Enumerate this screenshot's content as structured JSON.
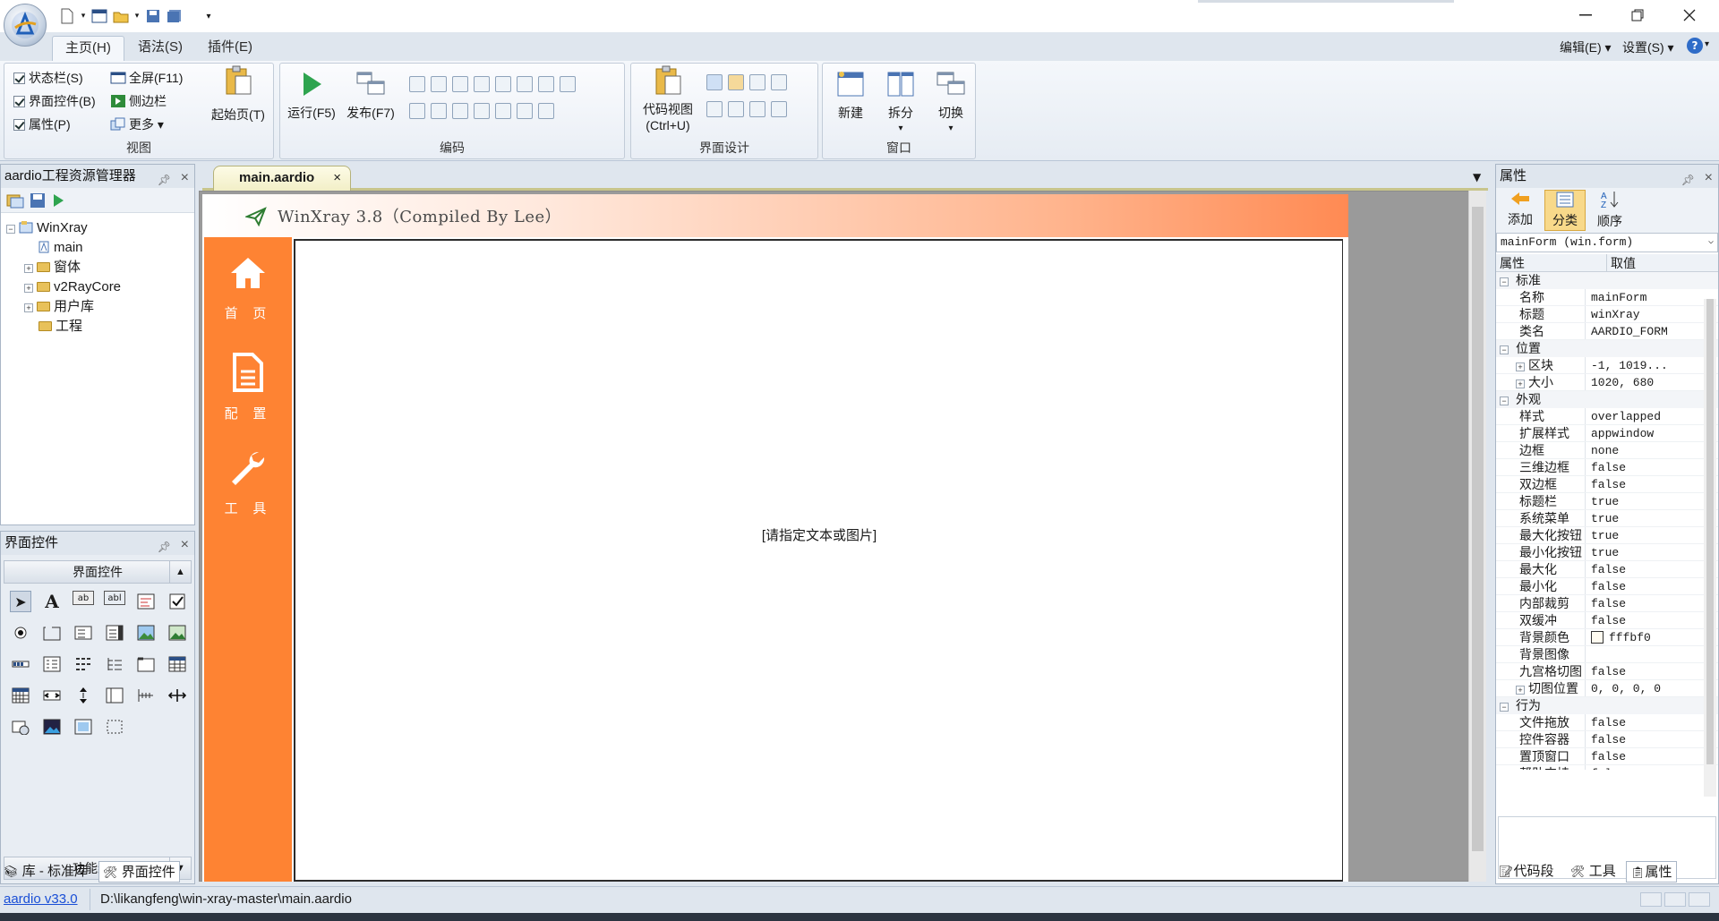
{
  "titlebar": {
    "window_buttons": [
      "minimize-icon",
      "restore-icon",
      "close-icon"
    ]
  },
  "ribbon": {
    "tabs": [
      "主页(H)",
      "语法(S)",
      "插件(E)"
    ],
    "right_menu": {
      "edit": "编辑(E)",
      "settings": "设置(S)"
    },
    "view_group": {
      "label": "视图",
      "statusbar": "状态栏(S)",
      "ui_controls": "界面控件(B)",
      "properties": "属性(P)",
      "fullscreen": "全屏(F11)",
      "sidebar": "侧边栏",
      "more": "更多",
      "start_page": "起始页(T)"
    },
    "code_group": {
      "label": "编码",
      "run": "运行(F5)",
      "publish": "发布(F7)"
    },
    "ui_design_group": {
      "label": "界面设计",
      "code_view": "代码视图",
      "code_view_shortcut": "(Ctrl+U)"
    },
    "window_group": {
      "label": "窗口",
      "new": "新建",
      "split": "拆分",
      "switch": "切换"
    }
  },
  "project_explorer": {
    "title": "aardio工程资源管理器",
    "tree": {
      "root": "WinXray",
      "main": "main",
      "forms": "窗体",
      "v2raycore": "v2RayCore",
      "user_lib": "用户库",
      "project": "工程"
    }
  },
  "controls_panel": {
    "title": "界面控件",
    "section_header": "界面控件",
    "footer_section": "功能组件"
  },
  "left_bottom_tabs": {
    "lib": "库 - 标准库",
    "controls": "界面控件"
  },
  "document": {
    "tab": "main.aardio",
    "form_title": "WinXray 3.8（Compiled By Lee）",
    "nav": [
      {
        "label": "首 页",
        "icon": "home-icon"
      },
      {
        "label": "配 置",
        "icon": "document-icon"
      },
      {
        "label": "工 具",
        "icon": "wrench-icon"
      }
    ],
    "placeholder": "[请指定文本或图片]"
  },
  "properties_panel": {
    "title": "属性",
    "toolbar": {
      "add": "添加",
      "categorize": "分类",
      "order": "顺序"
    },
    "object_selector": "mainForm (win.form)",
    "headers": {
      "name": "属性",
      "value": "取值"
    },
    "categories": [
      {
        "name": "标准",
        "rows": [
          {
            "name": "名称",
            "value": "mainForm"
          },
          {
            "name": "标题",
            "value": "winXray"
          },
          {
            "name": "类名",
            "value": "AARDIO_FORM"
          }
        ]
      },
      {
        "name": "位置",
        "rows": [
          {
            "name": "区块",
            "value": "-1, 1019...",
            "expandable": true
          },
          {
            "name": "大小",
            "value": "1020, 680",
            "expandable": true
          }
        ]
      },
      {
        "name": "外观",
        "rows": [
          {
            "name": "样式",
            "value": "overlapped"
          },
          {
            "name": "扩展样式",
            "value": "appwindow"
          },
          {
            "name": "边框",
            "value": "none"
          },
          {
            "name": "三维边框",
            "value": "false"
          },
          {
            "name": "双边框",
            "value": "false"
          },
          {
            "name": "标题栏",
            "value": "true"
          },
          {
            "name": "系统菜单",
            "value": "true"
          },
          {
            "name": "最大化按钮",
            "value": "true"
          },
          {
            "name": "最小化按钮",
            "value": "true"
          },
          {
            "name": "最大化",
            "value": "false"
          },
          {
            "name": "最小化",
            "value": "false"
          },
          {
            "name": "内部裁剪",
            "value": "false"
          },
          {
            "name": "双缓冲",
            "value": "false"
          },
          {
            "name": "背景颜色",
            "value": "fffbf0",
            "swatch": "#fffbf0"
          },
          {
            "name": "背景图像",
            "value": ""
          },
          {
            "name": "九宫格切图",
            "value": "false"
          },
          {
            "name": "切图位置",
            "value": "0, 0, 0, 0",
            "expandable": true
          }
        ]
      },
      {
        "name": "行为",
        "rows": [
          {
            "name": "文件拖放",
            "value": "false"
          },
          {
            "name": "控件容器",
            "value": "false"
          },
          {
            "name": "置顶窗口",
            "value": "false"
          },
          {
            "name": "帮助支持",
            "value": "false"
          }
        ]
      }
    ],
    "bottom_tabs": {
      "snippets": "代码段",
      "tools": "工具",
      "properties": "属性"
    }
  },
  "statusbar": {
    "version_link": "aardio v33.0",
    "path": "D:\\likangfeng\\win-xray-master\\main.aardio"
  },
  "colors": {
    "accent_orange": "#fe8333",
    "header_gradient_end": "#ff8a53",
    "ribbon_bg": "#e6ecf3",
    "link_blue": "#1a4fd6"
  }
}
